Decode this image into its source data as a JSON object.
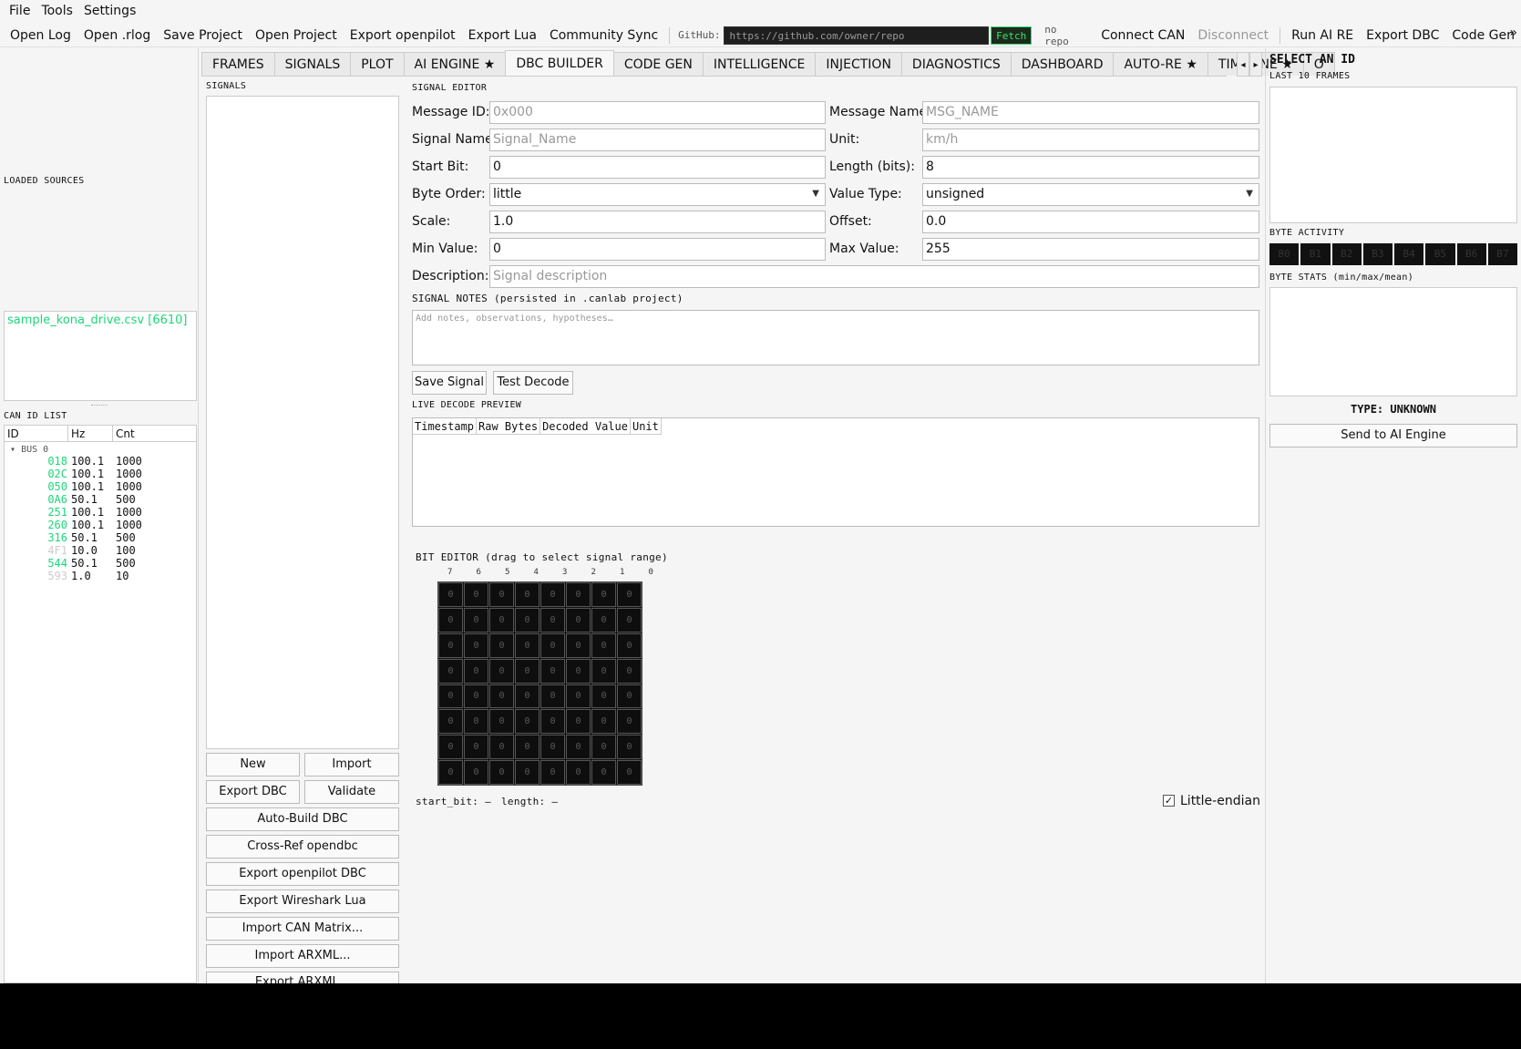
{
  "menu": [
    "File",
    "Tools",
    "Settings"
  ],
  "toolbar": {
    "open_log": "Open Log",
    "open_rlog": "Open .rlog",
    "save_project": "Save Project",
    "open_project": "Open Project",
    "export_openpilot": "Export openpilot",
    "export_lua": "Export Lua",
    "community_sync": "Community Sync",
    "github_label": "GitHub:",
    "github_placeholder": "https://github.com/owner/repo",
    "fetch": "Fetch",
    "repo_status": "no repo",
    "connect_can": "Connect CAN",
    "disconnect": "Disconnect",
    "run_ai_re": "Run AI RE",
    "export_dbc": "Export DBC",
    "code_gen": "Code Gen",
    "more": "»"
  },
  "left": {
    "loaded_sources_label": "LOADED SOURCES",
    "sources": [
      {
        "name": "sample_kona_drive.csv  [6610]"
      }
    ],
    "can_id_list_label": "CAN ID LIST",
    "columns": [
      "ID",
      "Hz",
      "Cnt"
    ],
    "bus_label": "BUS 0",
    "rows": [
      {
        "id": "018",
        "hz": "100.1",
        "cnt": "1000",
        "color": "#1dd67a"
      },
      {
        "id": "02C",
        "hz": "100.1",
        "cnt": "1000",
        "color": "#1dd67a"
      },
      {
        "id": "050",
        "hz": "100.1",
        "cnt": "1000",
        "color": "#1dd67a"
      },
      {
        "id": "0A6",
        "hz": "50.1",
        "cnt": "500",
        "color": "#1dd67a"
      },
      {
        "id": "251",
        "hz": "100.1",
        "cnt": "1000",
        "color": "#1dd67a"
      },
      {
        "id": "260",
        "hz": "100.1",
        "cnt": "1000",
        "color": "#1dd67a"
      },
      {
        "id": "316",
        "hz": "50.1",
        "cnt": "500",
        "color": "#1dd67a"
      },
      {
        "id": "4F1",
        "hz": "10.0",
        "cnt": "100",
        "color": "#cccccc"
      },
      {
        "id": "544",
        "hz": "50.1",
        "cnt": "500",
        "color": "#1dd67a"
      },
      {
        "id": "593",
        "hz": "1.0",
        "cnt": "10",
        "color": "#cccccc"
      }
    ]
  },
  "tabs": [
    "FRAMES",
    "SIGNALS",
    "PLOT",
    "AI ENGINE ★",
    "DBC BUILDER",
    "CODE GEN",
    "INTELLIGENCE",
    "INJECTION",
    "DIAGNOSTICS",
    "DASHBOARD",
    "AUTO-RE ★",
    "TIMELINE ★",
    "O"
  ],
  "active_tab": "DBC BUILDER",
  "signals_panel": {
    "label": "SIGNALS",
    "new": "New",
    "import": "Import",
    "export_dbc": "Export DBC",
    "validate": "Validate",
    "auto_build": "Auto-Build DBC",
    "cross_ref": "Cross-Ref opendbc",
    "export_openpilot_dbc": "Export openpilot DBC",
    "export_wireshark": "Export Wireshark Lua",
    "import_can_matrix": "Import CAN Matrix...",
    "import_arxml": "Import ARXML...",
    "export_arxml": "Export ARXML..."
  },
  "editor": {
    "title": "SIGNAL EDITOR",
    "message_id_label": "Message ID:",
    "message_id_placeholder": "0x000",
    "message_name_label": "Message Name:",
    "message_name_placeholder": "MSG_NAME",
    "signal_name_label": "Signal Name:",
    "signal_name_placeholder": "Signal_Name",
    "unit_label": "Unit:",
    "unit_placeholder": "km/h",
    "start_bit_label": "Start Bit:",
    "start_bit_value": "0",
    "length_label": "Length (bits):",
    "length_value": "8",
    "byte_order_label": "Byte Order:",
    "byte_order_value": "little",
    "value_type_label": "Value Type:",
    "value_type_value": "unsigned",
    "scale_label": "Scale:",
    "scale_value": "1.0",
    "offset_label": "Offset:",
    "offset_value": "0.0",
    "min_label": "Min Value:",
    "min_value": "0",
    "max_label": "Max Value:",
    "max_value": "255",
    "description_label": "Description:",
    "description_placeholder": "Signal description",
    "notes_label": "SIGNAL NOTES  (persisted in .canlab project)",
    "notes_placeholder": "Add notes, observations, hypotheses…",
    "save_signal": "Save Signal",
    "test_decode": "Test Decode",
    "live_decode_label": "LIVE DECODE PREVIEW",
    "decode_columns": [
      "Timestamp",
      "Raw Bytes",
      "Decoded Value",
      "Unit"
    ]
  },
  "bit_editor": {
    "label": "BIT EDITOR  (drag to select signal range)",
    "bit_headers": [
      "7",
      "6",
      "5",
      "4",
      "3",
      "2",
      "1",
      "0"
    ],
    "cell_value": "0",
    "start_bit_text": "start_bit: —",
    "length_text": "length: —",
    "little_endian_label": "Little-endian",
    "little_endian_checked": "✓"
  },
  "right": {
    "title": "SELECT AN ID",
    "last_frames_label": "LAST 10 FRAMES",
    "byte_activity_label": "BYTE ACTIVITY",
    "bytes": [
      "B0",
      "B1",
      "B2",
      "B3",
      "B4",
      "B5",
      "B6",
      "B7"
    ],
    "byte_stats_label": "BYTE STATS (min/max/mean)",
    "type_label": "TYPE: UNKNOWN",
    "send_ai": "Send to AI Engine"
  }
}
